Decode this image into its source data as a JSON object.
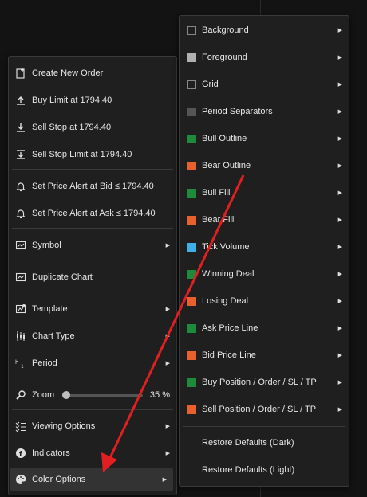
{
  "main_menu": {
    "create_new_order": "Create New Order",
    "buy_limit": "Buy Limit at 1794.40",
    "sell_stop": "Sell Stop at 1794.40",
    "sell_stop_limit": "Sell Stop Limit at 1794.40",
    "alert_bid": "Set Price Alert at Bid ≤ 1794.40",
    "alert_ask": "Set Price Alert at Ask ≤ 1794.40",
    "symbol": "Symbol",
    "duplicate_chart": "Duplicate Chart",
    "template": "Template",
    "chart_type": "Chart Type",
    "period": "Period",
    "zoom_label": "Zoom",
    "zoom_value": "35 %",
    "zoom_level_percent": 35,
    "viewing_options": "Viewing Options",
    "indicators": "Indicators",
    "color_options": "Color Options"
  },
  "color_menu": {
    "items": [
      {
        "label": "Background",
        "color": "#1f1f1f"
      },
      {
        "label": "Foreground",
        "color": "#b0b0b0"
      },
      {
        "label": "Grid",
        "color": "#1f1f1f"
      },
      {
        "label": "Period Separators",
        "color": "#555555"
      },
      {
        "label": "Bull Outline",
        "color": "#1e8a3c"
      },
      {
        "label": "Bear Outline",
        "color": "#e8602c"
      },
      {
        "label": "Bull Fill",
        "color": "#1e8a3c"
      },
      {
        "label": "Bear Fill",
        "color": "#e8602c"
      },
      {
        "label": "Tick Volume",
        "color": "#3db0e8"
      },
      {
        "label": "Winning Deal",
        "color": "#1e8a3c"
      },
      {
        "label": "Losing Deal",
        "color": "#e8602c"
      },
      {
        "label": "Ask Price Line",
        "color": "#1e8a3c"
      },
      {
        "label": "Bid Price Line",
        "color": "#e8602c"
      },
      {
        "label": "Buy Position / Order / SL / TP",
        "color": "#1e8a3c"
      },
      {
        "label": "Sell Position / Order / SL / TP",
        "color": "#e8602c"
      }
    ],
    "restore_dark": "Restore Defaults (Dark)",
    "restore_light": "Restore Defaults (Light)"
  },
  "annotation_color": "#e02020"
}
